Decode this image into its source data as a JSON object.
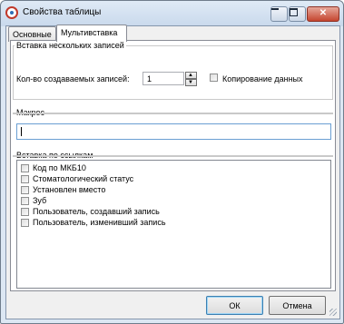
{
  "window": {
    "title": "Свойства таблицы",
    "app_icon": "app-logo-icon"
  },
  "caption_buttons": {
    "minimize": "minimize-icon",
    "maximize": "maximize-icon",
    "close": "close-icon",
    "close_glyph": "✕"
  },
  "tabs": [
    {
      "label": "Основные",
      "selected": false
    },
    {
      "label": "Мультивставка",
      "selected": true
    }
  ],
  "multi_insert": {
    "group_title": "Вставка нескольких записей",
    "count_label": "Кол-во создаваемых записей:",
    "count_value": "1",
    "copy_data_label": "Копирование данных",
    "copy_data_checked": false
  },
  "macro": {
    "label": "Макрос",
    "value": ""
  },
  "links": {
    "group_title": "Вставка по ссылкам",
    "items": [
      {
        "label": "Код по МКБ10",
        "checked": false
      },
      {
        "label": "Стоматологический статус",
        "checked": false
      },
      {
        "label": "Установлен вместо",
        "checked": false
      },
      {
        "label": "Зуб",
        "checked": false
      },
      {
        "label": "Пользователь, создавший запись",
        "checked": false
      },
      {
        "label": "Пользователь, изменивший запись",
        "checked": false
      }
    ]
  },
  "buttons": {
    "ok": "ОК",
    "cancel": "Отмена"
  },
  "colors": {
    "title_bar": "#c9d9ec",
    "close_button": "#c5452f",
    "focus_border": "#6a9fd3"
  }
}
